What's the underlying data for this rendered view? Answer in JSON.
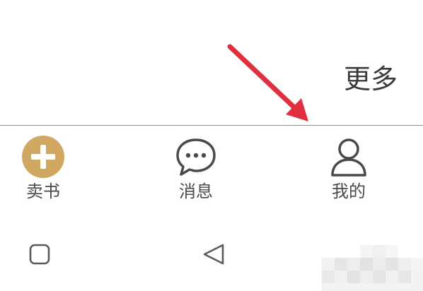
{
  "header": {
    "more_label": "更多"
  },
  "tabs": [
    {
      "label": "卖书",
      "icon": "add-circle-icon",
      "color": "#D1A862"
    },
    {
      "label": "消息",
      "icon": "chat-bubble-icon",
      "color": "#4a4a4a"
    },
    {
      "label": "我的",
      "icon": "person-icon",
      "color": "#4a4a4a"
    }
  ],
  "annotation": {
    "icon": "red-arrow-icon",
    "color": "#E0303F"
  },
  "system_nav": {
    "recent_icon": "square-icon",
    "back_icon": "back-triangle-icon"
  }
}
